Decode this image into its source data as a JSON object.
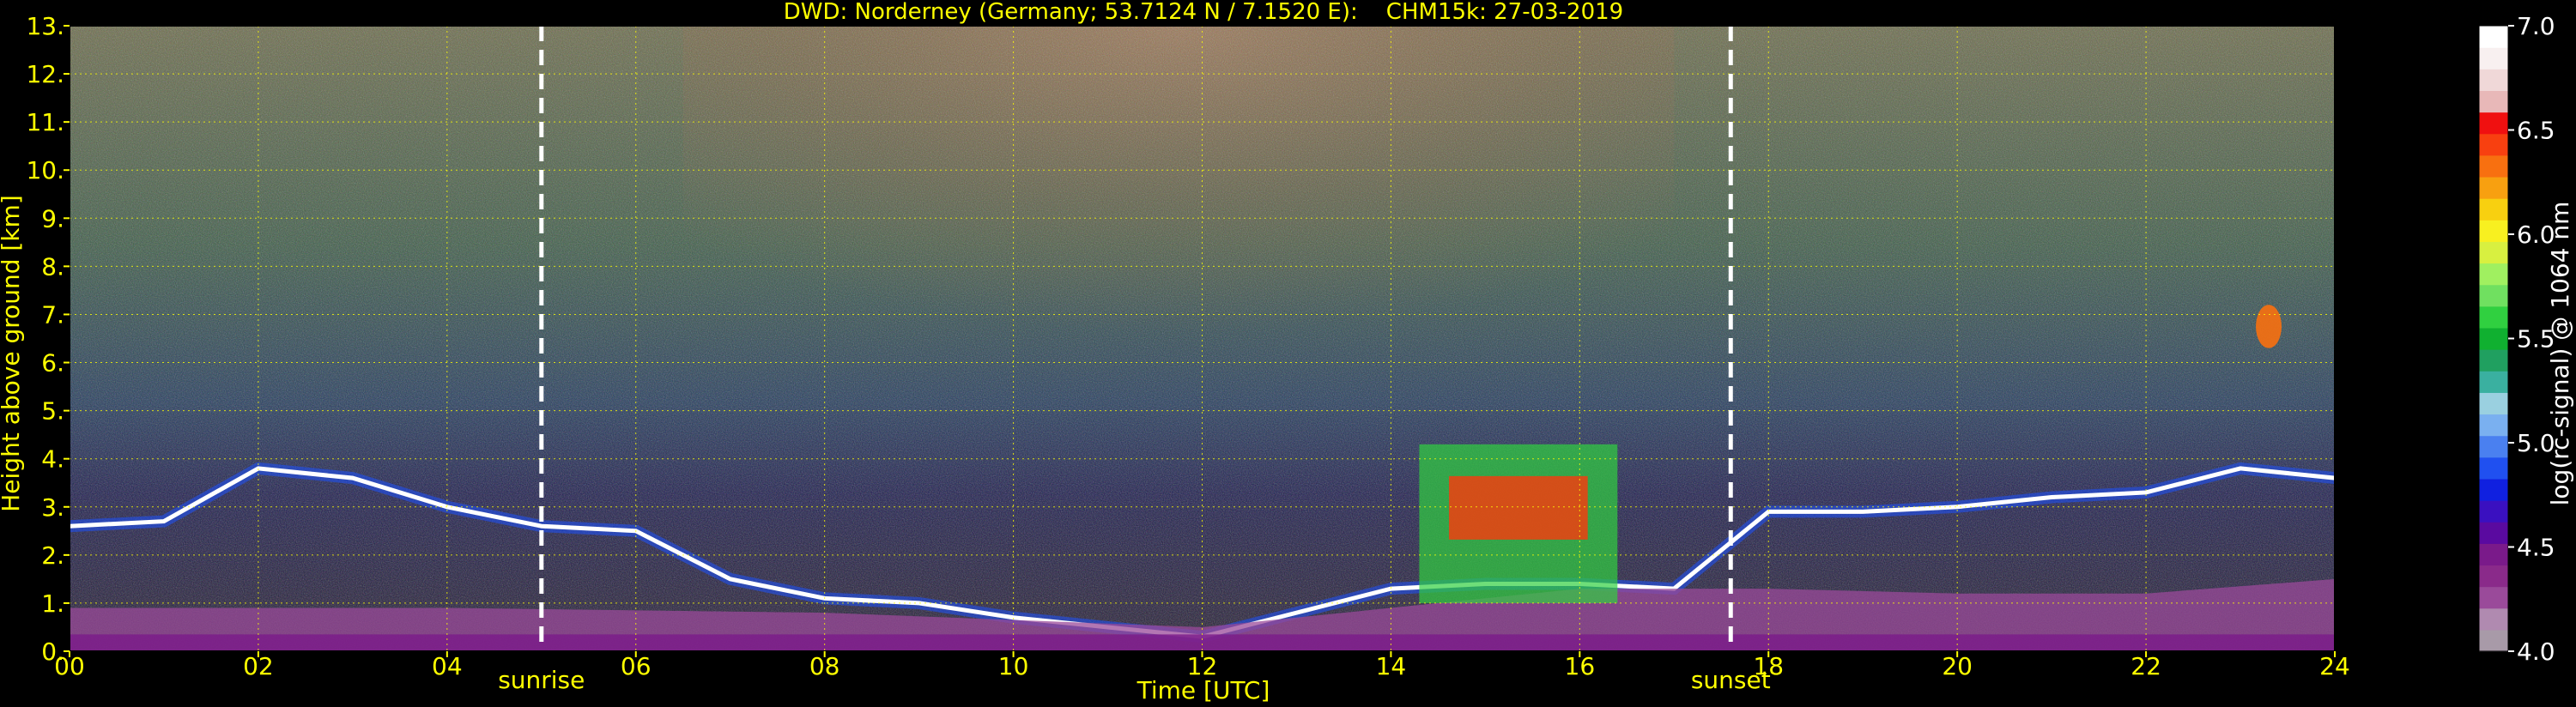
{
  "chart_data": {
    "type": "heatmap",
    "title": "DWD: Norderney (Germany; 53.7124 N / 7.1520 E):    CHM15k: 27-03-2019",
    "xlabel": "Time [UTC]",
    "ylabel": "Height above ground [km]",
    "xlim": [
      0,
      24
    ],
    "ylim": [
      0,
      13
    ],
    "x_ticks": [
      "00",
      "02",
      "04",
      "06",
      "08",
      "10",
      "12",
      "14",
      "16",
      "18",
      "20",
      "22",
      "24"
    ],
    "y_ticks": [
      "0.",
      "1.",
      "2.",
      "3.",
      "4.",
      "5.",
      "6.",
      "7.",
      "8.",
      "9.",
      "10.",
      "11.",
      "12.",
      "13."
    ],
    "grid": true,
    "colorbar": {
      "label": "log(rc-signal) @ 1064 nm",
      "range": [
        4.0,
        7.0
      ],
      "ticks": [
        "4.0",
        "4.5",
        "5.0",
        "5.5",
        "6.0",
        "6.5",
        "7.0"
      ],
      "colors": [
        "#a89aa8",
        "#b08ab0",
        "#9a4a9a",
        "#8a2a8a",
        "#7a1a8a",
        "#5a0aa0",
        "#3a10c0",
        "#1020e0",
        "#2050f0",
        "#4a80f0",
        "#7ab0f0",
        "#9ad0e0",
        "#3ab0a0",
        "#20a060",
        "#10b030",
        "#30d040",
        "#70e060",
        "#a0f060",
        "#d8f040",
        "#f8f020",
        "#f8d010",
        "#f8a010",
        "#f87010",
        "#f84010",
        "#f01010",
        "#e8b8b8",
        "#f0d8d8",
        "#f8f0f0",
        "#ffffff"
      ]
    },
    "events": [
      {
        "label": "sunrise",
        "time_utc": 5.0
      },
      {
        "label": "sunset",
        "time_utc": 17.6
      }
    ],
    "features": [
      {
        "kind": "cloud_top",
        "x": [
          0.0,
          1.0,
          2.0,
          3.0,
          4.0,
          5.0,
          6.0,
          7.0,
          8.0,
          9.0,
          10.0,
          11.0,
          12.0,
          13.0,
          14.0,
          15.0,
          16.0,
          17.0,
          18.0,
          19.0,
          20.0,
          21.0,
          22.0,
          23.0,
          24.0
        ],
        "y": [
          2.6,
          2.7,
          3.8,
          3.6,
          3.0,
          2.6,
          2.5,
          1.5,
          1.1,
          1.0,
          0.7,
          0.5,
          0.3,
          0.8,
          1.3,
          1.4,
          1.4,
          1.3,
          2.9,
          2.9,
          3.0,
          3.2,
          3.3,
          3.8,
          3.6
        ]
      },
      {
        "kind": "boundary_layer_top",
        "x": [
          0,
          4,
          8,
          12,
          16,
          18,
          20,
          22,
          24
        ],
        "y": [
          0.9,
          0.9,
          0.8,
          0.5,
          1.3,
          1.3,
          1.2,
          1.2,
          1.5
        ]
      },
      {
        "kind": "convective_cloud",
        "x": [
          14.3,
          16.4
        ],
        "y": [
          1.0,
          4.3
        ]
      },
      {
        "kind": "aerosol_layer",
        "x": [
          23.2,
          23.4
        ],
        "y": [
          6.3,
          7.2
        ]
      }
    ]
  }
}
